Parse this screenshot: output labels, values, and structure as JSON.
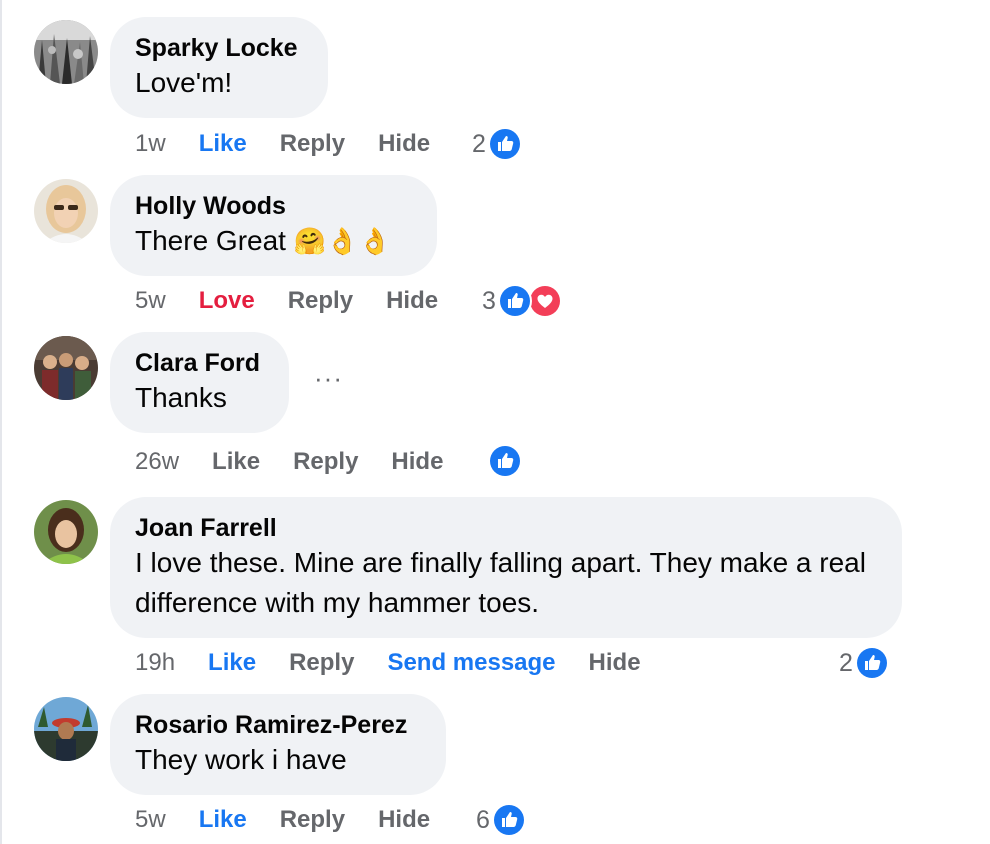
{
  "comments": [
    {
      "author": "Sparky Locke",
      "text": "Love'm!",
      "time": "1w",
      "reaction_action": "Like",
      "reply": "Reply",
      "hide": "Hide",
      "count": "2",
      "reactions": [
        "like-icon"
      ]
    },
    {
      "author": "Holly Woods",
      "text": "There Great",
      "emoji": "🤗👌👌",
      "time": "5w",
      "reaction_action": "Love",
      "reply": "Reply",
      "hide": "Hide",
      "count": "3",
      "reactions": [
        "like-icon",
        "heart-icon"
      ]
    },
    {
      "author": "Clara Ford",
      "text": "Thanks",
      "more": "···",
      "time": "26w",
      "reaction_action": "Like",
      "reply": "Reply",
      "hide": "Hide",
      "count": "",
      "reactions": [
        "like-icon"
      ]
    },
    {
      "author": "Joan Farrell",
      "text": "I love these. Mine are finally falling apart. They make a real difference with my hammer toes.",
      "time": "19h",
      "reaction_action": "Like",
      "reply": "Reply",
      "send_message": "Send message",
      "hide": "Hide",
      "count": "2",
      "reactions": [
        "like-icon"
      ]
    },
    {
      "author": "Rosario Ramirez-Perez",
      "text": "They work i have",
      "time": "5w",
      "reaction_action": "Like",
      "reply": "Reply",
      "hide": "Hide",
      "count": "6",
      "reactions": [
        "like-icon"
      ]
    }
  ],
  "colors": {
    "like_blue": "#1877f2",
    "love_red": "#e41e3f",
    "bubble_bg": "#f0f2f5",
    "secondary_text": "#65676b"
  }
}
